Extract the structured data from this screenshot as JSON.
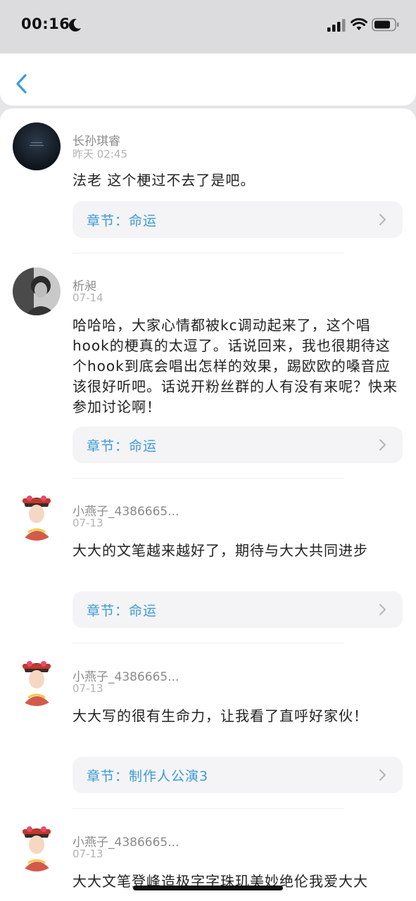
{
  "status_bar": {
    "time": "00:16"
  },
  "comments": [
    {
      "username": "长孙琪睿",
      "date": "昨天 02:45",
      "text": "法老 这个梗过不去了是吧。",
      "chapter": "章节：命运"
    },
    {
      "username": "析昶",
      "date": "07-14",
      "text": "哈哈哈，大家心情都被kc调动起来了，这个唱hook的梗真的太逗了。话说回来，我也很期待这个hook到底会唱出怎样的效果，踢欧欧的嗓音应该很好听吧。话说开粉丝群的人有没有来呢？快来参加讨论啊！",
      "chapter": "章节：命运"
    },
    {
      "username": "小燕子_4386665...",
      "date": "07-13",
      "text": "大大的文笔越来越好了，期待与大大共同进步",
      "chapter": "章节：命运"
    },
    {
      "username": "小燕子_4386665...",
      "date": "07-13",
      "text": "大大写的很有生命力，让我看了直呼好家伙！",
      "chapter": "章节：制作人公演3"
    },
    {
      "username": "小燕子_4386665...",
      "date": "07-13",
      "text": "大大文笔登峰造极字字珠玑美妙绝伦我爱大大"
    }
  ]
}
